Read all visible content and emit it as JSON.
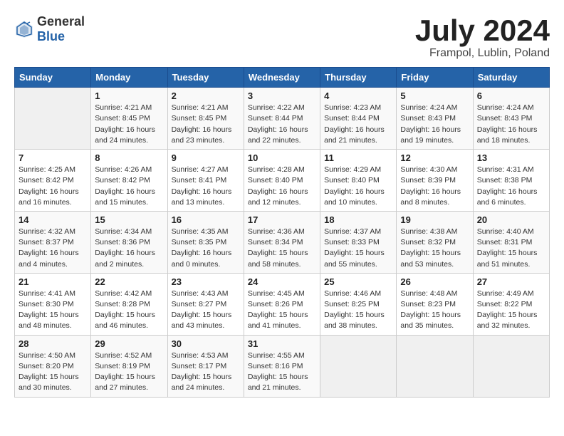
{
  "header": {
    "logo_general": "General",
    "logo_blue": "Blue",
    "title": "July 2024",
    "location": "Frampol, Lublin, Poland"
  },
  "days_of_week": [
    "Sunday",
    "Monday",
    "Tuesday",
    "Wednesday",
    "Thursday",
    "Friday",
    "Saturday"
  ],
  "weeks": [
    [
      {
        "day": "",
        "info": ""
      },
      {
        "day": "1",
        "info": "Sunrise: 4:21 AM\nSunset: 8:45 PM\nDaylight: 16 hours\nand 24 minutes."
      },
      {
        "day": "2",
        "info": "Sunrise: 4:21 AM\nSunset: 8:45 PM\nDaylight: 16 hours\nand 23 minutes."
      },
      {
        "day": "3",
        "info": "Sunrise: 4:22 AM\nSunset: 8:44 PM\nDaylight: 16 hours\nand 22 minutes."
      },
      {
        "day": "4",
        "info": "Sunrise: 4:23 AM\nSunset: 8:44 PM\nDaylight: 16 hours\nand 21 minutes."
      },
      {
        "day": "5",
        "info": "Sunrise: 4:24 AM\nSunset: 8:43 PM\nDaylight: 16 hours\nand 19 minutes."
      },
      {
        "day": "6",
        "info": "Sunrise: 4:24 AM\nSunset: 8:43 PM\nDaylight: 16 hours\nand 18 minutes."
      }
    ],
    [
      {
        "day": "7",
        "info": "Sunrise: 4:25 AM\nSunset: 8:42 PM\nDaylight: 16 hours\nand 16 minutes."
      },
      {
        "day": "8",
        "info": "Sunrise: 4:26 AM\nSunset: 8:42 PM\nDaylight: 16 hours\nand 15 minutes."
      },
      {
        "day": "9",
        "info": "Sunrise: 4:27 AM\nSunset: 8:41 PM\nDaylight: 16 hours\nand 13 minutes."
      },
      {
        "day": "10",
        "info": "Sunrise: 4:28 AM\nSunset: 8:40 PM\nDaylight: 16 hours\nand 12 minutes."
      },
      {
        "day": "11",
        "info": "Sunrise: 4:29 AM\nSunset: 8:40 PM\nDaylight: 16 hours\nand 10 minutes."
      },
      {
        "day": "12",
        "info": "Sunrise: 4:30 AM\nSunset: 8:39 PM\nDaylight: 16 hours\nand 8 minutes."
      },
      {
        "day": "13",
        "info": "Sunrise: 4:31 AM\nSunset: 8:38 PM\nDaylight: 16 hours\nand 6 minutes."
      }
    ],
    [
      {
        "day": "14",
        "info": "Sunrise: 4:32 AM\nSunset: 8:37 PM\nDaylight: 16 hours\nand 4 minutes."
      },
      {
        "day": "15",
        "info": "Sunrise: 4:34 AM\nSunset: 8:36 PM\nDaylight: 16 hours\nand 2 minutes."
      },
      {
        "day": "16",
        "info": "Sunrise: 4:35 AM\nSunset: 8:35 PM\nDaylight: 16 hours\nand 0 minutes."
      },
      {
        "day": "17",
        "info": "Sunrise: 4:36 AM\nSunset: 8:34 PM\nDaylight: 15 hours\nand 58 minutes."
      },
      {
        "day": "18",
        "info": "Sunrise: 4:37 AM\nSunset: 8:33 PM\nDaylight: 15 hours\nand 55 minutes."
      },
      {
        "day": "19",
        "info": "Sunrise: 4:38 AM\nSunset: 8:32 PM\nDaylight: 15 hours\nand 53 minutes."
      },
      {
        "day": "20",
        "info": "Sunrise: 4:40 AM\nSunset: 8:31 PM\nDaylight: 15 hours\nand 51 minutes."
      }
    ],
    [
      {
        "day": "21",
        "info": "Sunrise: 4:41 AM\nSunset: 8:30 PM\nDaylight: 15 hours\nand 48 minutes."
      },
      {
        "day": "22",
        "info": "Sunrise: 4:42 AM\nSunset: 8:28 PM\nDaylight: 15 hours\nand 46 minutes."
      },
      {
        "day": "23",
        "info": "Sunrise: 4:43 AM\nSunset: 8:27 PM\nDaylight: 15 hours\nand 43 minutes."
      },
      {
        "day": "24",
        "info": "Sunrise: 4:45 AM\nSunset: 8:26 PM\nDaylight: 15 hours\nand 41 minutes."
      },
      {
        "day": "25",
        "info": "Sunrise: 4:46 AM\nSunset: 8:25 PM\nDaylight: 15 hours\nand 38 minutes."
      },
      {
        "day": "26",
        "info": "Sunrise: 4:48 AM\nSunset: 8:23 PM\nDaylight: 15 hours\nand 35 minutes."
      },
      {
        "day": "27",
        "info": "Sunrise: 4:49 AM\nSunset: 8:22 PM\nDaylight: 15 hours\nand 32 minutes."
      }
    ],
    [
      {
        "day": "28",
        "info": "Sunrise: 4:50 AM\nSunset: 8:20 PM\nDaylight: 15 hours\nand 30 minutes."
      },
      {
        "day": "29",
        "info": "Sunrise: 4:52 AM\nSunset: 8:19 PM\nDaylight: 15 hours\nand 27 minutes."
      },
      {
        "day": "30",
        "info": "Sunrise: 4:53 AM\nSunset: 8:17 PM\nDaylight: 15 hours\nand 24 minutes."
      },
      {
        "day": "31",
        "info": "Sunrise: 4:55 AM\nSunset: 8:16 PM\nDaylight: 15 hours\nand 21 minutes."
      },
      {
        "day": "",
        "info": ""
      },
      {
        "day": "",
        "info": ""
      },
      {
        "day": "",
        "info": ""
      }
    ]
  ]
}
